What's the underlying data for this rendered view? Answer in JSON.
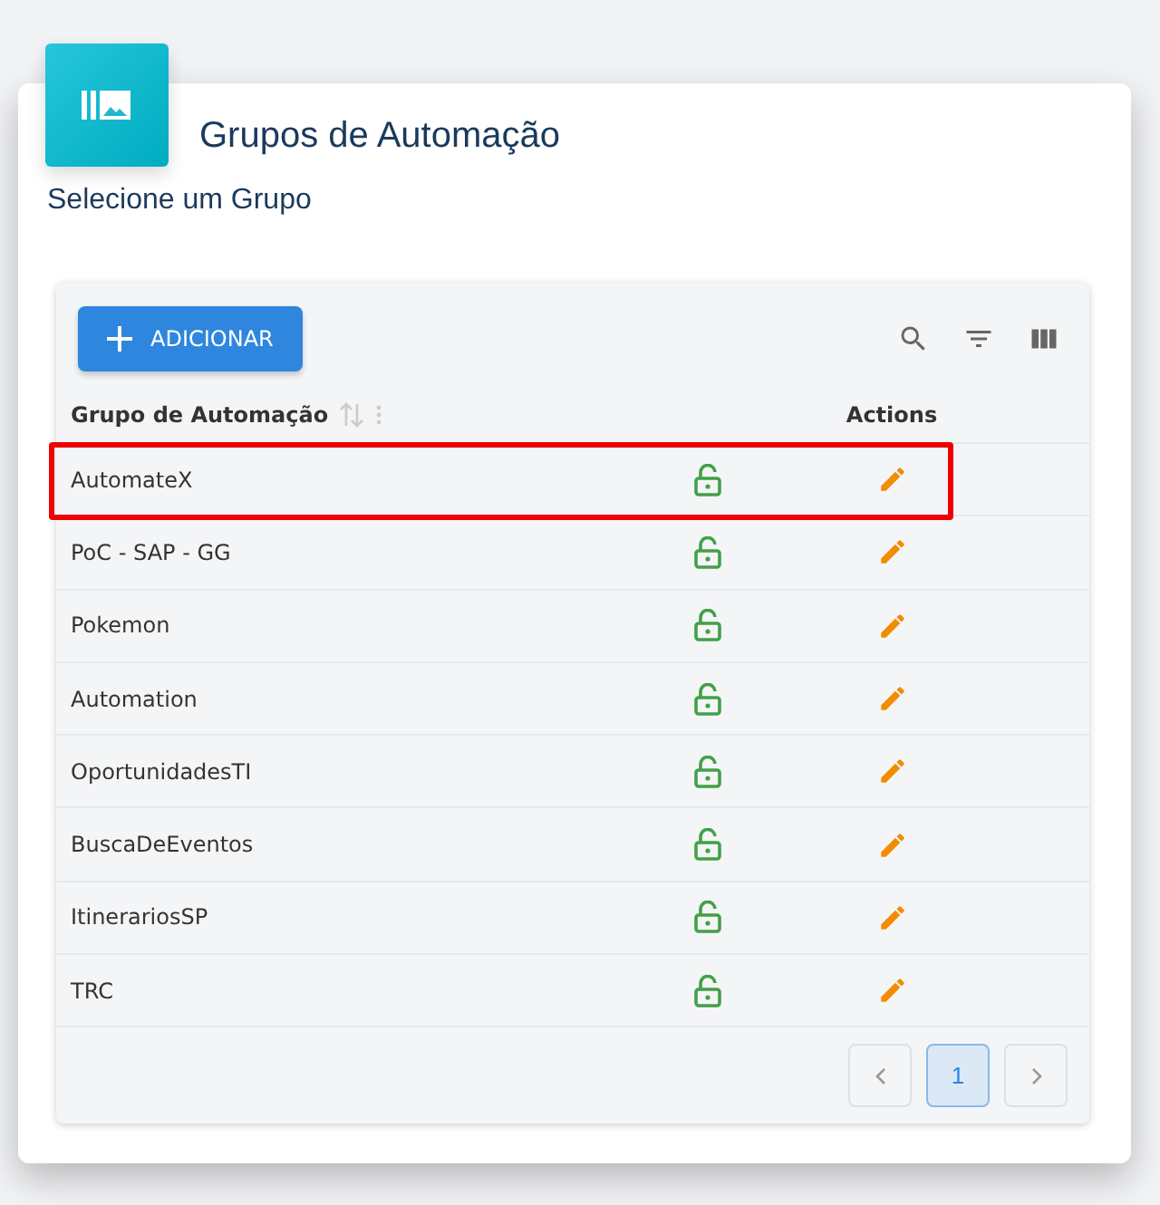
{
  "header": {
    "title": "Grupos de Automação",
    "subtitle": "Selecione um Grupo"
  },
  "toolbar": {
    "add_button": "ADICIONAR"
  },
  "table": {
    "columns": [
      {
        "label": "Grupo de Automação"
      },
      {
        "label": "Actions"
      }
    ],
    "rows": [
      {
        "name": "AutomateX",
        "highlighted": true
      },
      {
        "name": "PoC - SAP - GG",
        "highlighted": false
      },
      {
        "name": "Pokemon",
        "highlighted": false
      },
      {
        "name": "Automation",
        "highlighted": false
      },
      {
        "name": "OportunidadesTI",
        "highlighted": false
      },
      {
        "name": "BuscaDeEventos",
        "highlighted": false
      },
      {
        "name": "ItinerariosSP",
        "highlighted": false
      },
      {
        "name": "TRC",
        "highlighted": false
      }
    ]
  },
  "pagination": {
    "pages": [
      {
        "label": "1",
        "selected": true
      }
    ]
  }
}
